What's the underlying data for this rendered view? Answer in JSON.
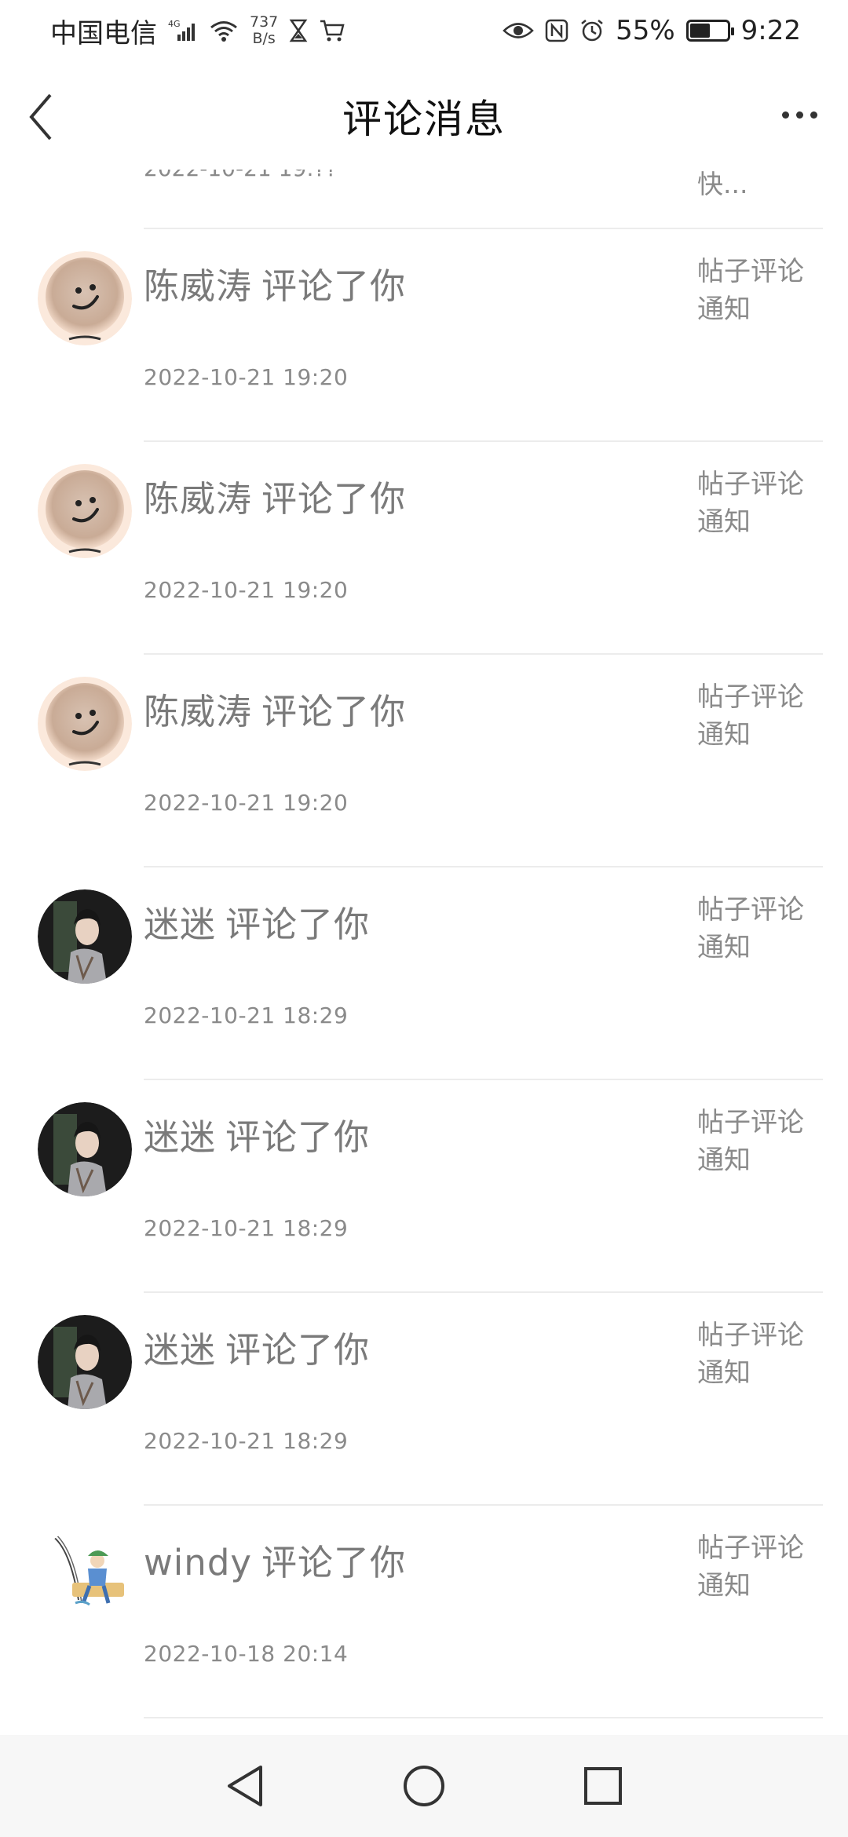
{
  "status_bar": {
    "carrier": "中国电信",
    "network": "4G",
    "speed_value": "737",
    "speed_unit": "B/s",
    "battery": "55%",
    "time": "9:22"
  },
  "header": {
    "title": "评论消息"
  },
  "partial_item": {
    "time": "2022-10-21 19:??",
    "type": "快..."
  },
  "items": [
    {
      "name": "陈威涛",
      "action": "评论了你",
      "time": "2022-10-21 19:20",
      "type_line1": "帖子评论",
      "type_line2": "通知",
      "avatar": "smiley-avatar"
    },
    {
      "name": "陈威涛",
      "action": "评论了你",
      "time": "2022-10-21 19:20",
      "type_line1": "帖子评论",
      "type_line2": "通知",
      "avatar": "smiley-avatar"
    },
    {
      "name": "陈威涛",
      "action": "评论了你",
      "time": "2022-10-21 19:20",
      "type_line1": "帖子评论",
      "type_line2": "通知",
      "avatar": "smiley-avatar"
    },
    {
      "name": "迷迷",
      "action": "评论了你",
      "time": "2022-10-21 18:29",
      "type_line1": "帖子评论",
      "type_line2": "通知",
      "avatar": "photo-avatar"
    },
    {
      "name": "迷迷",
      "action": "评论了你",
      "time": "2022-10-21 18:29",
      "type_line1": "帖子评论",
      "type_line2": "通知",
      "avatar": "photo-avatar"
    },
    {
      "name": "迷迷",
      "action": "评论了你",
      "time": "2022-10-21 18:29",
      "type_line1": "帖子评论",
      "type_line2": "通知",
      "avatar": "photo-avatar"
    },
    {
      "name": "windy",
      "action": "评论了你",
      "time": "2022-10-18 20:14",
      "type_line1": "帖子评论",
      "type_line2": "通知",
      "avatar": "fishing-avatar"
    }
  ],
  "colors": {
    "secondary_text": "#8a8a8a",
    "divider": "#ececec",
    "nav_background": "#f7f7f7"
  }
}
